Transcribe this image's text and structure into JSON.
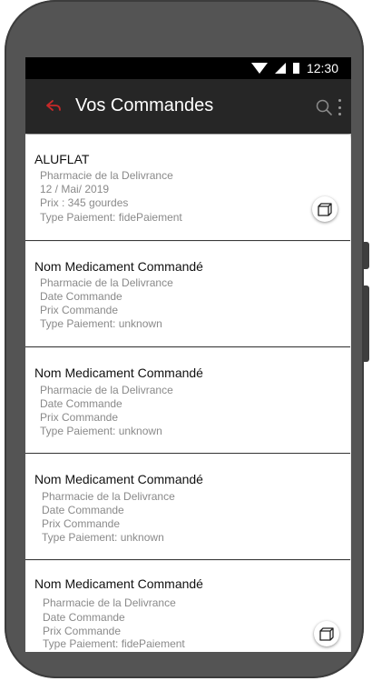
{
  "status_bar": {
    "time": "12:30"
  },
  "app_bar": {
    "title": "Vos Commandes"
  },
  "orders": [
    {
      "name": "ALUFLAT",
      "pharmacy": "Pharmacie de la Delivrance",
      "date": "12 / Mai/ 2019",
      "price": "Prix : 345 gourdes",
      "payment": "Type Paiement:     fidePaiement",
      "has_action": true
    },
    {
      "name": "Nom Medicament Commandé",
      "pharmacy": "Pharmacie de la Delivrance",
      "date": "Date Commande",
      "price": "Prix Commande",
      "payment": "Type Paiement:     unknown",
      "has_action": false
    },
    {
      "name": "Nom Medicament Commandé",
      "pharmacy": "Pharmacie de la Delivrance",
      "date": "Date Commande",
      "price": "Prix Commande",
      "payment": "Type Paiement: unknown",
      "has_action": false
    },
    {
      "name": "Nom Medicament Commandé",
      "pharmacy": "Pharmacie de la Delivrance",
      "date": "Date Commande",
      "price": "Prix Commande",
      "payment": "Type Paiement: unknown",
      "has_action": false
    },
    {
      "name": "Nom Medicament Commandé",
      "pharmacy": "Pharmacie de la Delivrance",
      "date": "Date Commande",
      "price": "Prix Commande",
      "payment": "Type Paiement:     fidePaiement",
      "has_action": true
    }
  ],
  "colors": {
    "accent": "#c62828",
    "app_bar": "#262626",
    "status_bar": "#000000"
  }
}
